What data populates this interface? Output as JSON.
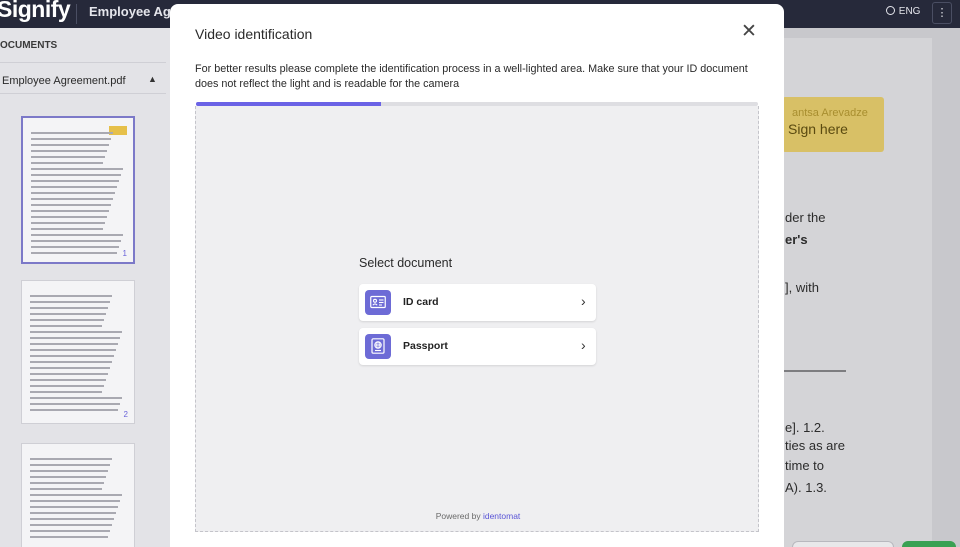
{
  "app": {
    "logo": "Signify",
    "document_title": "Employee Agre",
    "language": "ENG",
    "menu_icon": "vertical-dots-icon"
  },
  "sidebar": {
    "heading": "OCUMENTS",
    "file": "Employee Agreement.pdf",
    "pages": [
      {
        "number": "1",
        "active": true
      },
      {
        "number": "2",
        "active": false
      }
    ]
  },
  "document": {
    "signer_name": "antsa Arevadze",
    "sign_here_label": "Sign here",
    "visible_fragments": [
      {
        "text": "der the",
        "bold": false
      },
      {
        "text": "er's",
        "bold": true
      },
      {
        "text": "], with",
        "bold": false
      },
      {
        "text": "e]. 1.2.",
        "bold": false
      },
      {
        "text": "ties as are",
        "bold": false
      },
      {
        "text": "time to",
        "bold": false
      },
      {
        "text": "A). 1.3.",
        "bold": false
      }
    ]
  },
  "modal": {
    "title": "Video identification",
    "close_icon": "close-icon",
    "instructions": "For better results please complete the identification process in a well-lighted area. Make sure that your ID document does not reflect the light and is readable for the camera",
    "progress_fraction": 0.33,
    "select_heading": "Select document",
    "options": [
      {
        "label": "ID card",
        "icon": "id-card-icon"
      },
      {
        "label": "Passport",
        "icon": "passport-icon"
      }
    ],
    "powered_by_prefix": "Powered by ",
    "powered_by_brand": "identomat"
  },
  "colors": {
    "topbar": "#26293a",
    "accent": "#6b63e6",
    "option_icon_bg": "#6d6bd6",
    "sign_box": "#d8c066"
  }
}
